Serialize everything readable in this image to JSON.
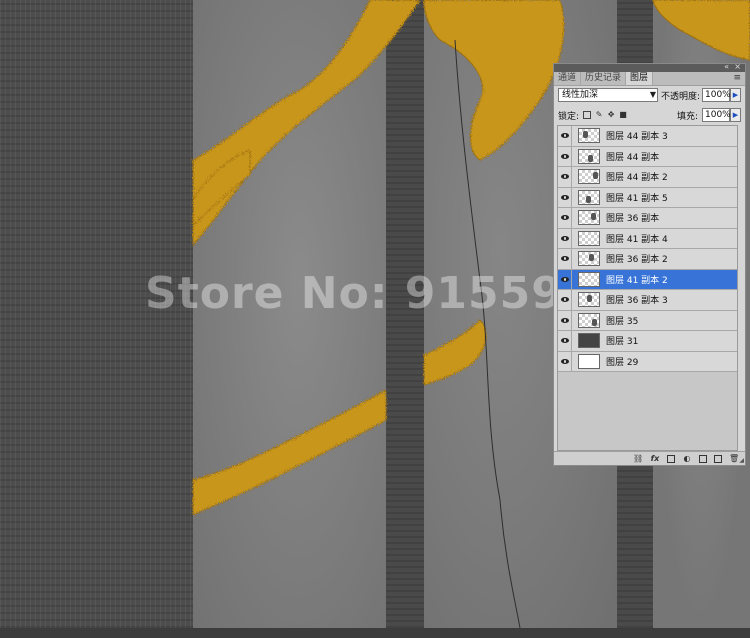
{
  "watermark": "Store No: 91559",
  "art_colors": {
    "gold": "#c9961a",
    "gold_dark": "#9c6f10"
  },
  "layers_panel": {
    "collapse_icon": "«",
    "close_icon": "×",
    "tabs": [
      {
        "label": "通道",
        "active": false
      },
      {
        "label": "历史记录",
        "active": false
      },
      {
        "label": "图层",
        "active": true
      }
    ],
    "menu_icon": "≡",
    "blend_mode": "线性加深",
    "blend_arrow": "▼",
    "opacity_label": "不透明度:",
    "opacity_value": "100%",
    "lock_label": "锁定:",
    "fill_label": "填充:",
    "fill_value": "100%",
    "stepper_icon": "▶",
    "selected_color": "#3874d8",
    "layers": [
      {
        "name": "图层 44 副本 3",
        "thumb": "mark",
        "selected": false
      },
      {
        "name": "图层 44 副本",
        "thumb": "mark",
        "selected": false
      },
      {
        "name": "图层 44 副本 2",
        "thumb": "mark",
        "selected": false
      },
      {
        "name": "图层 41 副本 5",
        "thumb": "mark",
        "selected": false
      },
      {
        "name": "图层 36 副本",
        "thumb": "mark",
        "selected": false
      },
      {
        "name": "图层 41 副本 4",
        "thumb": "blank",
        "selected": false
      },
      {
        "name": "图层 36 副本 2",
        "thumb": "mark",
        "selected": false
      },
      {
        "name": "图层 41 副本 2",
        "thumb": "blank",
        "selected": true
      },
      {
        "name": "图层 36 副本 3",
        "thumb": "mark",
        "selected": false
      },
      {
        "name": "图层 35",
        "thumb": "mark",
        "selected": false
      },
      {
        "name": "图层 31",
        "thumb": "dark",
        "selected": false
      },
      {
        "name": "图层 29",
        "thumb": "white",
        "selected": false
      }
    ],
    "footer_icons": [
      "link-icon",
      "fx-icon",
      "mask-icon",
      "adjustment-icon",
      "group-icon",
      "new-layer-icon",
      "trash-icon"
    ]
  }
}
